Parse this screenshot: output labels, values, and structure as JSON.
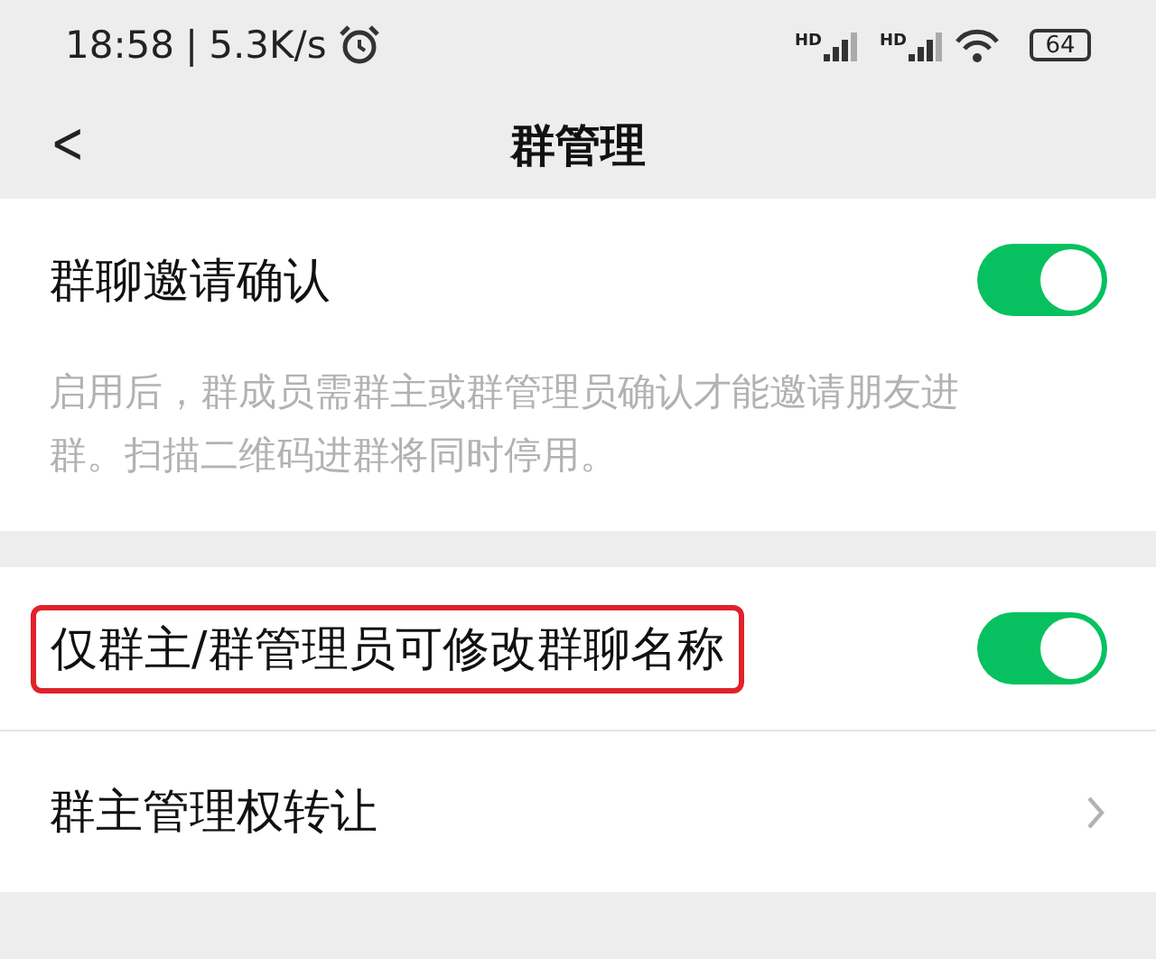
{
  "status_bar": {
    "time": "18:58",
    "separator": "|",
    "speed": "5.3K/s",
    "signals": [
      {
        "label": "HD"
      },
      {
        "label": "HD"
      }
    ],
    "battery": "64"
  },
  "nav": {
    "back": "<",
    "title": "群管理"
  },
  "sections": [
    {
      "rows": [
        {
          "kind": "toggle",
          "label": "群聊邀请确认",
          "on": true,
          "highlighted": false,
          "description": "启用后，群成员需群主或群管理员确认才能邀请朋友进群。扫描二维码进群将同时停用。"
        }
      ]
    },
    {
      "rows": [
        {
          "kind": "toggle",
          "label": "仅群主/群管理员可修改群聊名称",
          "on": true,
          "highlighted": true
        },
        {
          "kind": "link",
          "label": "群主管理权转让",
          "highlighted": false
        }
      ]
    }
  ]
}
